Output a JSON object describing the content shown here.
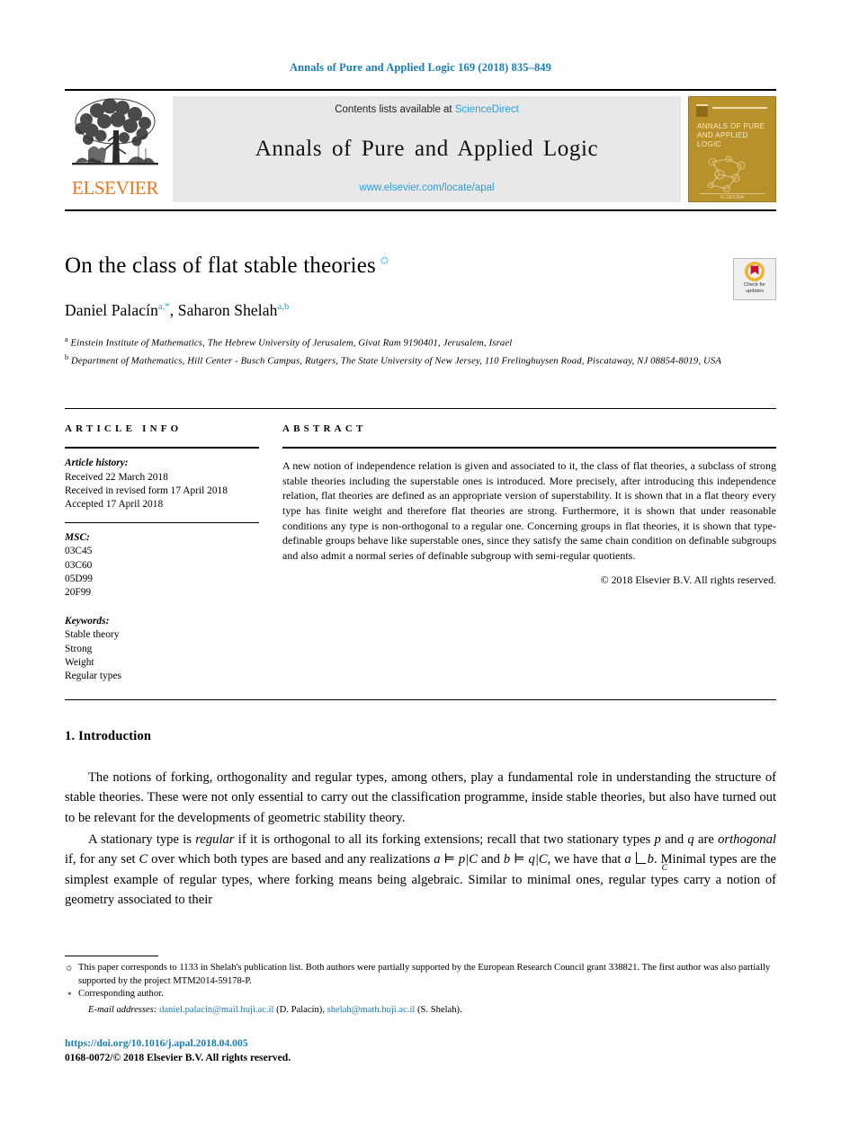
{
  "running_head": "Annals of Pure and Applied Logic 169 (2018) 835–849",
  "masthead": {
    "elsevier_wordmark": "ELSEVIER",
    "contents_prefix": "Contents lists available at ",
    "contents_link": "ScienceDirect",
    "journal_name": "Annals of Pure and Applied Logic",
    "journal_url": "www.elsevier.com/locate/apal",
    "cover_title": "ANNALS OF PURE AND APPLIED LOGIC",
    "cover_footer": "ELSEVIER",
    "cover_color": "#b8912a"
  },
  "title_block": {
    "title": "On the class of flat stable theories",
    "title_footnote_mark": "✩",
    "authors": "Daniel Palacín",
    "author1_marks": "a,*",
    "authors_sep": ", ",
    "author2": "Saharon Shelah",
    "author2_marks": "a,b",
    "affiliation_a_mark": "a",
    "affiliation_a": "Einstein Institute of Mathematics, The Hebrew University of Jerusalem, Givat Ram 9190401, Jerusalem, Israel",
    "affiliation_b_mark": "b",
    "affiliation_b": "Department of Mathematics, Hill Center - Busch Campus, Rutgers, The State University of New Jersey, 110 Frelinghuysen Road, Piscataway, NJ 08854-8019, USA",
    "crossmark_line1": "Check for",
    "crossmark_line2": "updates"
  },
  "article_info": {
    "heading": "ARTICLE INFO",
    "history_label": "Article history:",
    "history": [
      "Received 22 March 2018",
      "Received in revised form 17 April 2018",
      "Accepted 17 April 2018"
    ],
    "msc_label": "MSC:",
    "msc": [
      "03C45",
      "03C60",
      "05D99",
      "20F99"
    ],
    "keywords_label": "Keywords:",
    "keywords": [
      "Stable theory",
      "Strong",
      "Weight",
      "Regular types"
    ]
  },
  "abstract": {
    "heading": "ABSTRACT",
    "text": "A new notion of independence relation is given and associated to it, the class of flat theories, a subclass of strong stable theories including the superstable ones is introduced. More precisely, after introducing this independence relation, flat theories are defined as an appropriate version of superstability. It is shown that in a flat theory every type has finite weight and therefore flat theories are strong. Furthermore, it is shown that under reasonable conditions any type is non-orthogonal to a regular one. Concerning groups in flat theories, it is shown that type-definable groups behave like superstable ones, since they satisfy the same chain condition on definable subgroups and also admit a normal series of definable subgroup with semi-regular quotients.",
    "copyright": "© 2018 Elsevier B.V. All rights reserved."
  },
  "body": {
    "section_title": "1. Introduction",
    "paragraph1": "The notions of forking, orthogonality and regular types, among others, play a fundamental role in understanding the structure of stable theories. These were not only essential to carry out the classification programme, inside stable theories, but also have turned out to be relevant for the developments of geometric stability theory.",
    "p2_part1": "A stationary type is ",
    "p2_em1": "regular",
    "p2_part2": " if it is orthogonal to all its forking extensions; recall that two stationary types ",
    "p2_mi_p": "p",
    "p2_part3": " and ",
    "p2_mi_q": "q",
    "p2_part4": " are ",
    "p2_em2": "orthogonal",
    "p2_part5": " if, for any set ",
    "p2_mi_C": "C",
    "p2_part6": " over which both types are based and any realizations ",
    "p2_math1": "a ⊨ p|C",
    "p2_part7": " and ",
    "p2_math2": "b ⊨ q|C",
    "p2_part8": ", we have that ",
    "p2_math3_a": "a",
    "p2_math3_sub": "C",
    "p2_math3_b": "b",
    "p2_part9": ". Minimal types are the simplest example of regular types, where forking means being algebraic. Similar to minimal ones, regular types carry a notion of geometry associated to their"
  },
  "footnotes": {
    "star_mark": "✩",
    "star_text": "This paper corresponds to 1133 in Shelah's publication list. Both authors were partially supported by the European Research Council grant 338821. The first author was also partially supported by the project MTM2014-59178-P.",
    "corresponding_mark": "*",
    "corresponding_text": "Corresponding author.",
    "email_label": "E-mail addresses:",
    "email1": "daniel.palacin@mail.huji.ac.il",
    "email1_who": " (D. Palacín), ",
    "email2": "shelah@math.huji.ac.il",
    "email2_who": " (S. Shelah)."
  },
  "footer": {
    "doi": "https://doi.org/10.1016/j.apal.2018.04.005",
    "issn": "0168-0072/© 2018 Elsevier B.V. All rights reserved."
  }
}
